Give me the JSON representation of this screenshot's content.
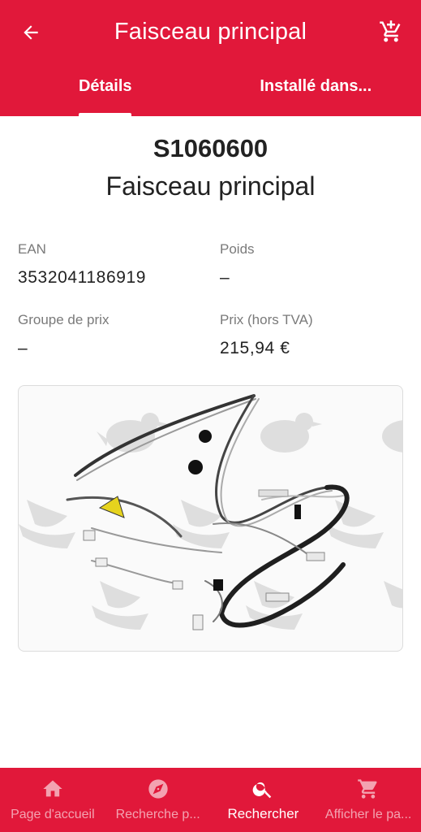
{
  "header": {
    "title": "Faisceau principal",
    "tabs": [
      {
        "label": "Détails",
        "active": true
      },
      {
        "label": "Installé dans..."
      }
    ]
  },
  "product": {
    "reference": "S1060600",
    "name": "Faisceau principal",
    "fields": {
      "ean_label": "EAN",
      "ean_value": "3532041186919",
      "weight_label": "Poids",
      "weight_value": "–",
      "price_group_label": "Groupe de prix",
      "price_group_value": "–",
      "price_label": "Prix (hors TVA)",
      "price_value": "215,94 €"
    }
  },
  "bottom_nav": [
    {
      "label": "Page d'accueil",
      "icon": "home-icon"
    },
    {
      "label": "Recherche p...",
      "icon": "compass-icon"
    },
    {
      "label": "Rechercher",
      "icon": "search-icon",
      "active": true
    },
    {
      "label": "Afficher le pa...",
      "icon": "cart-icon"
    }
  ],
  "colors": {
    "brand": "#e1183a"
  }
}
